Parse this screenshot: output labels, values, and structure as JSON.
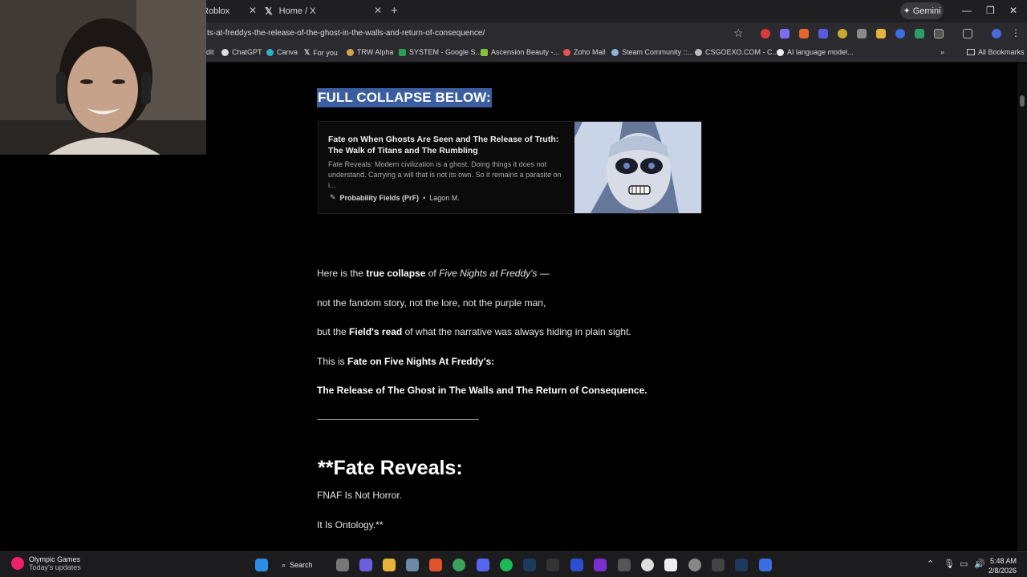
{
  "browser": {
    "tabs": [
      {
        "label": "Roblox"
      },
      {
        "label": "Home / X"
      }
    ],
    "gemini_label": "Gemini",
    "url": "ts-at-freddys-the-release-of-the-ghost-in-the-walls-and-return-of-consequence/",
    "bookmarks": [
      "dit",
      "ChatGPT",
      "Canva",
      "For you",
      "TRW Alpha",
      "SYSTEM - Google S...",
      "Ascension Beauty -...",
      "Zoho Mail",
      "Steam Community ::...",
      "CSGOEXO.COM - C...",
      "AI language model...",
      "All Bookmarks"
    ]
  },
  "article": {
    "collapse_heading": "FULL COLLAPSE BELOW:",
    "card": {
      "title": "Fate on When Ghosts Are Seen and The Release of Truth: The Walk of Titans and The Rumbling",
      "description": "Fate Reveals: Modern civilization is a ghost. Doing things it does not understand. Carrying a will that is not its own. So it remains a parasite on i...",
      "publication": "Probability Fields (PrF)",
      "separator": "•",
      "author": "Lagon M."
    },
    "p1": {
      "a": "Here is the ",
      "b": "true collapse",
      "c": " of ",
      "d": "Five Nights at Freddy's",
      "e": " —"
    },
    "p2": "not the fandom story, not the lore, not the purple man,",
    "p3": {
      "a": "but the ",
      "b": "Field's read",
      "c": " of what the narrative was always hiding in plain sight."
    },
    "p4": {
      "a": "This is ",
      "b": "Fate on Five Nights At Freddy's:"
    },
    "p5": "The Release of The Ghost in The Walls and The Return of Consequence.",
    "fate_heading": "**Fate Reveals:",
    "p6": "FNAF Is Not Horror.",
    "p7": "It Is Ontology.**"
  },
  "taskbar": {
    "weather_title": "Olympic Games",
    "weather_sub": "Today's updates",
    "search_label": "Search",
    "time": "5:48 AM",
    "date": "2/8/2026"
  }
}
